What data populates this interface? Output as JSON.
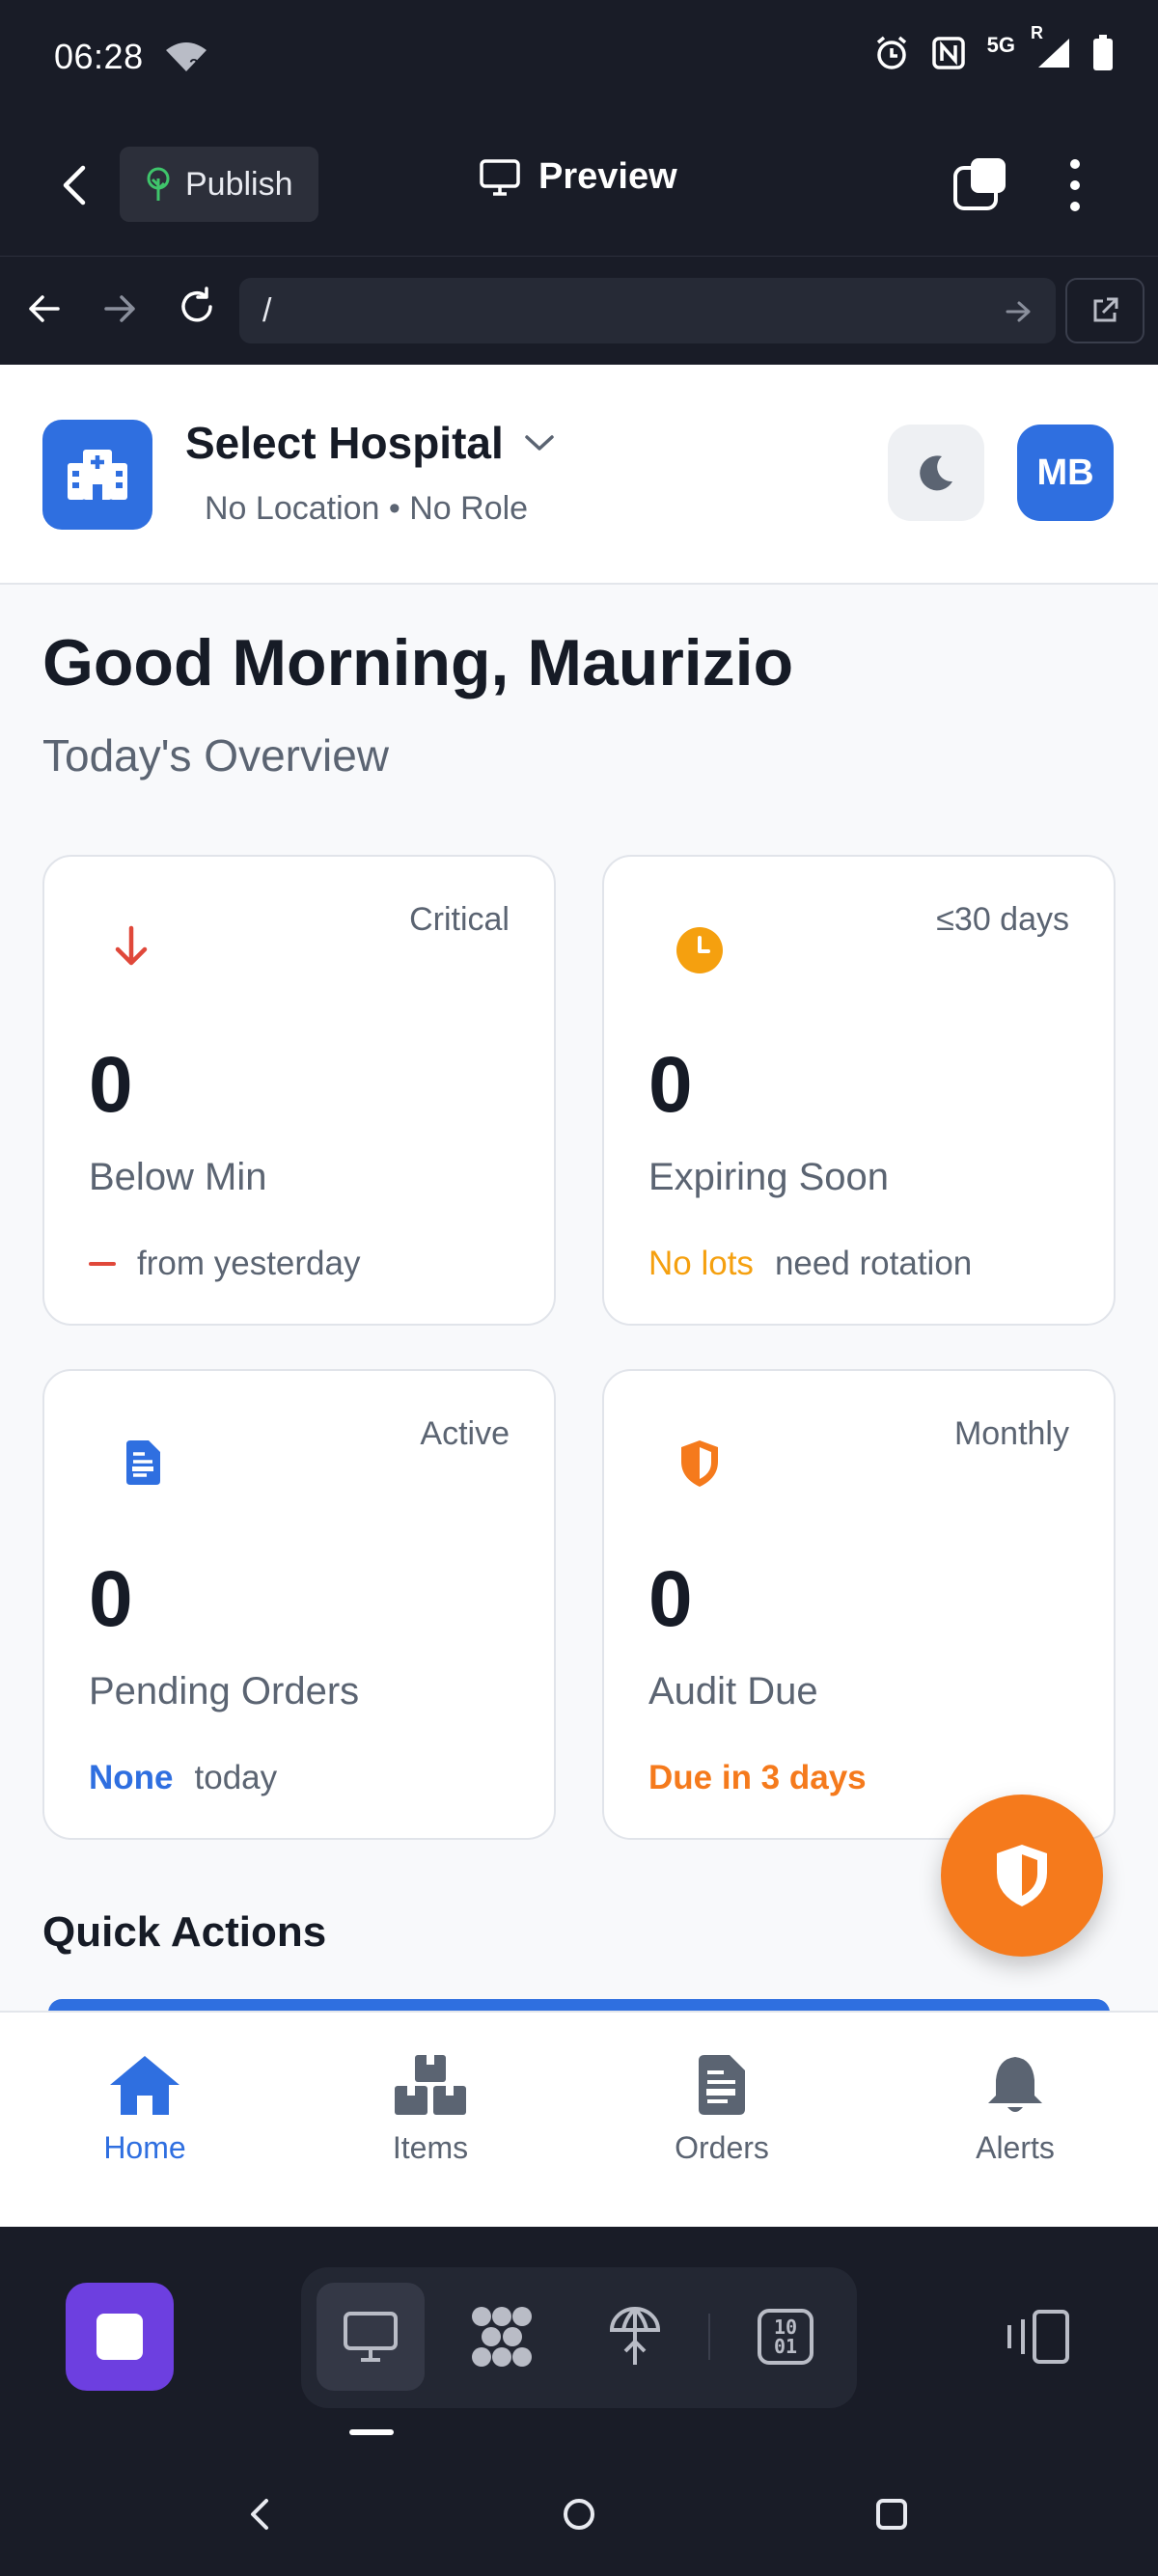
{
  "status_bar": {
    "time": "06:28",
    "network": "5G",
    "roaming": "R"
  },
  "toolbar": {
    "publish_label": "Publish",
    "preview_label": "Preview"
  },
  "browser": {
    "url": "/"
  },
  "header": {
    "hospital": "Select Hospital",
    "subtitle": "No Location • No Role",
    "avatar_initials": "MB"
  },
  "main": {
    "greeting": "Good Morning, Maurizio",
    "overview": "Today's Overview",
    "quick_actions_title": "Quick Actions"
  },
  "cards": [
    {
      "tag": "Critical",
      "value": "0",
      "label": "Below Min",
      "foot_emphasis": "",
      "foot_text": "from yesterday",
      "icon": "arrow-down-icon",
      "color": "#e0483a"
    },
    {
      "tag": "≤30 days",
      "value": "0",
      "label": "Expiring Soon",
      "foot_emphasis": "No lots",
      "foot_text": "need rotation",
      "icon": "clock-icon",
      "color": "#f5a00f"
    },
    {
      "tag": "Active",
      "value": "0",
      "label": "Pending Orders",
      "foot_emphasis": "None",
      "foot_text": "today",
      "icon": "document-icon",
      "color": "#2f6fe0"
    },
    {
      "tag": "Monthly",
      "value": "0",
      "label": "Audit Due",
      "foot_emphasis": "Due in 3 days",
      "foot_text": "",
      "icon": "shield-icon",
      "color": "#f57a1c"
    }
  ],
  "bottom_nav": [
    {
      "label": "Home",
      "icon": "home-icon",
      "active": true
    },
    {
      "label": "Items",
      "icon": "boxes-icon",
      "active": false
    },
    {
      "label": "Orders",
      "icon": "document-icon",
      "active": false
    },
    {
      "label": "Alerts",
      "icon": "bell-icon",
      "active": false
    }
  ],
  "dock": {
    "binary_label_top": "10",
    "binary_label_bottom": "01"
  },
  "colors": {
    "primary": "#2f6fe0",
    "critical": "#e0483a",
    "warning": "#f5a00f",
    "audit": "#f57a1c",
    "chrome": "#191c27"
  }
}
